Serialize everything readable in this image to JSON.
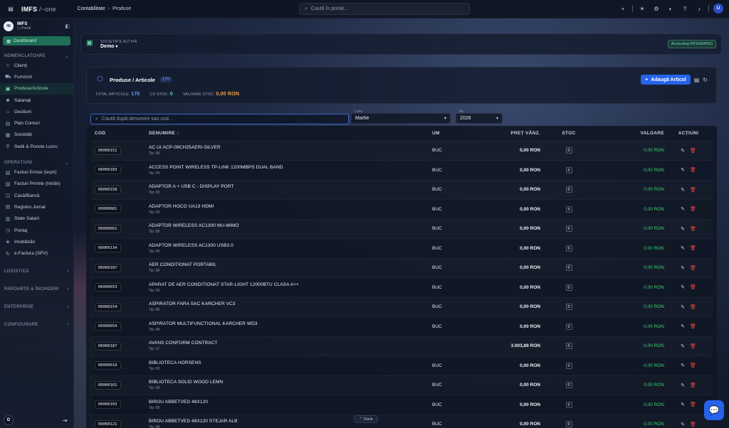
{
  "topbar": {
    "brand": "IMFS",
    "brand_suffix": "/~one",
    "crumb_1": "Contabilitate",
    "crumb_sep": "›",
    "crumb_2": "Produse",
    "search_placeholder": "Caută în portal...",
    "user_initial": "U"
  },
  "sidebar": {
    "app_title": "IMFS",
    "app_sub": "Portal",
    "dashboard": "Dashboard",
    "sec_nomenclatoare": "NOMENCLATOARE",
    "nomenclatoare": [
      {
        "label": "Clienți",
        "icon": "users-icon"
      },
      {
        "label": "Furnizori",
        "icon": "truck-icon"
      },
      {
        "label": "Produse/Articole",
        "icon": "box-icon",
        "active": true
      },
      {
        "label": "Salariați",
        "icon": "badge-icon"
      },
      {
        "label": "Gestiuni",
        "icon": "warehouse-icon"
      },
      {
        "label": "Plan Conturi",
        "icon": "ledger-icon"
      },
      {
        "label": "Societăți",
        "icon": "building-icon"
      },
      {
        "label": "Sedii & Puncte Lucru",
        "icon": "pin-icon"
      }
    ],
    "sec_operatiuni": "OPERAȚIUNI",
    "operatiuni": [
      {
        "label": "Facturi Emise (Ieșiri)",
        "icon": "invoice-out-icon"
      },
      {
        "label": "Facturi Primite (Intrări)",
        "icon": "invoice-in-icon"
      },
      {
        "label": "Casă/Bancă",
        "icon": "cash-icon"
      },
      {
        "label": "Registru Jurnal",
        "icon": "journal-icon"
      },
      {
        "label": "State Salarii",
        "icon": "payroll-icon"
      },
      {
        "label": "Pontaj",
        "icon": "clock-icon"
      },
      {
        "label": "Imobilizări",
        "icon": "asset-icon"
      },
      {
        "label": "e-Factura (SPV)",
        "icon": "sync-icon"
      }
    ],
    "sec_logistica": "LOGISTICĂ",
    "sec_rapoarte": "RAPOARTE & ÎNCHIDERI",
    "sec_enterprise": "ENTERPRISE",
    "sec_configurare": "CONFIGURARE",
    "avatar": "D"
  },
  "company": {
    "label": "SOCIETATE ACTIVĂ",
    "value": "Demo",
    "badge": "Accounting INTEGRATED"
  },
  "products": {
    "title": "Produse / Articole",
    "count": "170",
    "add_button": "Adaugă Articol",
    "total_label": "TOTAL ARTICOLE:",
    "total_value": "170",
    "stock_label": "CU STOC:",
    "stock_value": "0",
    "value_label": "VALOARE STOC:",
    "value_value": "0,00 RON"
  },
  "filters": {
    "search_placeholder": "Caută după denumire sau cod...",
    "month_label": "Luna",
    "month_value": "Martie",
    "year_label": "An",
    "year_value": "2026"
  },
  "table": {
    "headers": {
      "code": "COD",
      "name": "DENUMIRE",
      "um": "UM",
      "price": "PREȚ VÂNZ.",
      "stock": "STOC",
      "value": "VALOARE",
      "actions": "ACȚIUNI"
    },
    "rows": [
      {
        "code": "00000151",
        "name": "AC UI ACP-09CH25AERI-SILVER",
        "tip": "Tip: 08",
        "um": "BUC",
        "price": "0,00 RON",
        "stock": "0",
        "value": "0,00 RON"
      },
      {
        "code": "00000183",
        "name": "ACCESS POINT WIRELESS TP-LINK 1200MBPS DUAL BAND",
        "tip": "Tip: 09",
        "um": "BUC",
        "price": "0,00 RON",
        "stock": "0",
        "value": "0,00 RON"
      },
      {
        "code": "00000158",
        "name": "ADAPTOR A + USB C - DISPLAY PORT",
        "tip": "Tip: 08",
        "um": "BUC",
        "price": "0,00 RON",
        "stock": "0",
        "value": "0,00 RON"
      },
      {
        "code": "00000081",
        "name": "ADAPTOR HOCO UA13 HDMI",
        "tip": "Tip: 09",
        "um": "BUC",
        "price": "0,00 RON",
        "stock": "0",
        "value": "0,00 RON"
      },
      {
        "code": "00000061",
        "name": "ADAPTOR WIRELESS AC1300 MU-MIMO",
        "tip": "Tip: 08",
        "um": "BUC",
        "price": "0,00 RON",
        "stock": "0",
        "value": "0,00 RON"
      },
      {
        "code": "00000134",
        "name": "ADAPTOR WIRELESS AC1300 USB3.0",
        "tip": "Tip: 09",
        "um": "BUC",
        "price": "0,00 RON",
        "stock": "0",
        "value": "0,00 RON"
      },
      {
        "code": "00000107",
        "name": "AER CONDITIONAT PORTABIL",
        "tip": "Tip: 08",
        "um": "BUC",
        "price": "0,00 RON",
        "stock": "0",
        "value": "0,00 RON"
      },
      {
        "code": "00000053",
        "name": "APARAT DE AER CONDITIONAT STAR-LIGHT 12000BTU CLASA A++",
        "tip": "Tip: 09",
        "um": "BUC",
        "price": "0,00 RON",
        "stock": "0",
        "value": "0,00 RON"
      },
      {
        "code": "00000154",
        "name": "ASPIRATOR FARA SAC KARCHER VC3",
        "tip": "Tip: 08",
        "um": "BUC",
        "price": "0,00 RON",
        "stock": "0",
        "value": "0,00 RON"
      },
      {
        "code": "00000054",
        "name": "ASPIRATOR MULTIFUNCTIONAL KARCHER WD3",
        "tip": "Tip: 08",
        "um": "BUC",
        "price": "0,00 RON",
        "stock": "0",
        "value": "0,00 RON"
      },
      {
        "code": "00000187",
        "name": "AVANS CONFORM CONTRACT",
        "tip": "Tip: 17",
        "um": "",
        "price": "3.003,89 RON",
        "stock": "0",
        "value": "0,00 RON"
      },
      {
        "code": "00000018",
        "name": "BIBLIOTECA HORSENS",
        "tip": "Tip: 08",
        "um": "BUC",
        "price": "0,00 RON",
        "stock": "0",
        "value": "0,00 RON"
      },
      {
        "code": "00000161",
        "name": "BIBLIOTECA SOLID WOOD LEMN",
        "tip": "Tip: 08",
        "um": "BUC",
        "price": "0,00 RON",
        "stock": "0",
        "value": "0,00 RON"
      },
      {
        "code": "00000103",
        "name": "BIROU ABBETVED 48X120",
        "tip": "Tip: 08",
        "um": "BUC",
        "price": "0,00 RON",
        "stock": "0",
        "value": "0,00 RON"
      },
      {
        "code": "00000121",
        "name": "BIROU ABBETVED 48X120 STEJAR ALB",
        "tip": "Tip: 08",
        "um": "BUC",
        "price": "0,00 RON",
        "stock": "0",
        "value": "0,00 RON"
      }
    ]
  },
  "dock": {
    "label": "Dock"
  }
}
